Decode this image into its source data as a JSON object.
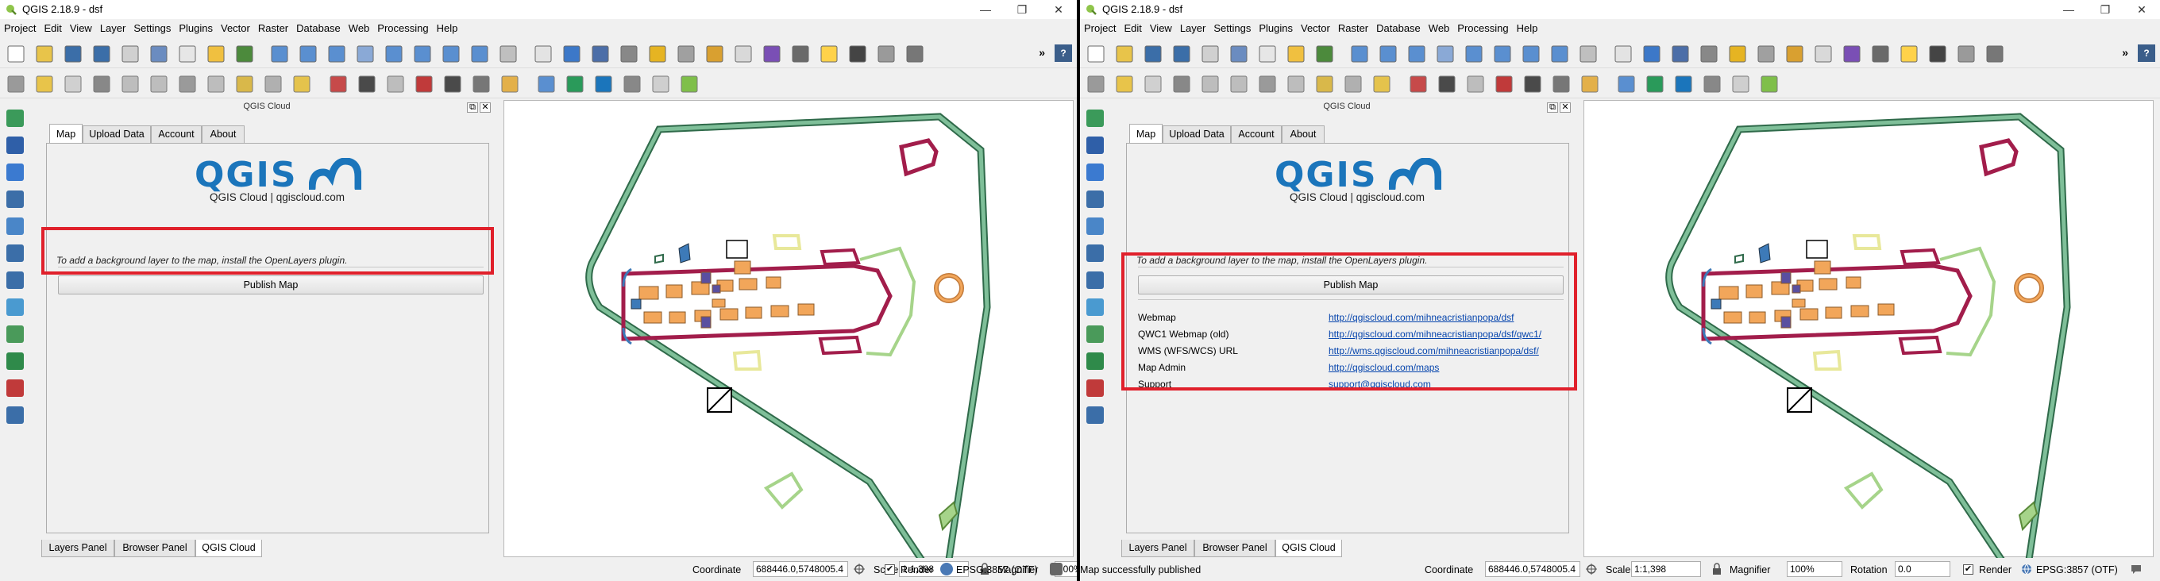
{
  "app": {
    "title": "QGIS 2.18.9 - dsf",
    "menu": [
      "Project",
      "Edit",
      "View",
      "Layer",
      "Settings",
      "Plugins",
      "Vector",
      "Raster",
      "Database",
      "Web",
      "Processing",
      "Help"
    ],
    "window_controls": {
      "minimize": "—",
      "maximize": "❐",
      "close": "✕"
    }
  },
  "dock": {
    "title": "QGIS Cloud",
    "float_btn": "⧉",
    "close_btn": "✕",
    "tabs": [
      "Map",
      "Upload Data",
      "Account",
      "About"
    ],
    "logo_text": "QGIS",
    "logo_subtitle": "QGIS Cloud | qgiscloud.com",
    "hint": "To add a background layer to the map, install the OpenLayers plugin.",
    "publish_button": "Publish Map",
    "links": [
      {
        "label": "Webmap",
        "url": "http://qgiscloud.com/mihneacristianpopa/dsf"
      },
      {
        "label": "QWC1 Webmap (old)",
        "url": "http://qgiscloud.com/mihneacristianpopa/dsf/qwc1/"
      },
      {
        "label": "WMS (WFS/WCS) URL",
        "url": "http://wms.qgiscloud.com/mihneacristianpopa/dsf/"
      },
      {
        "label": "Map Admin",
        "url": "http://qgiscloud.com/maps"
      },
      {
        "label": "Support",
        "url": "support@qgiscloud.com"
      }
    ]
  },
  "bottom_tabs": [
    "Layers Panel",
    "Browser Panel",
    "QGIS Cloud"
  ],
  "toolbar": {
    "more": "»",
    "help": "?"
  },
  "statusbar": {
    "message_right": "Map successfully published",
    "coordinate_label": "Coordinate",
    "coordinate_value": "688446.0,5748005.4",
    "scale_label": "Scale",
    "scale_value": "1:1,398",
    "magnifier_label": "Magnifier",
    "magnifier_value": "100%",
    "rotation_label": "Rotation",
    "rotation_value": "0.0",
    "render_label": "Render",
    "render_checked": "✔",
    "crs": "EPSG:3857 (OTF)"
  },
  "colors": {
    "highlight": "#e0202b",
    "qgis_blue": "#1b75bb",
    "link": "#0645ad",
    "wall_green": "#7fbf99",
    "room_red": "#a21d4b",
    "room_orange": "#f2a65a",
    "room_purple": "#5a4fa0",
    "room_blue": "#3d7ab8",
    "room_lightgreen": "#a6d48a",
    "room_yellow": "#e8e89a"
  }
}
